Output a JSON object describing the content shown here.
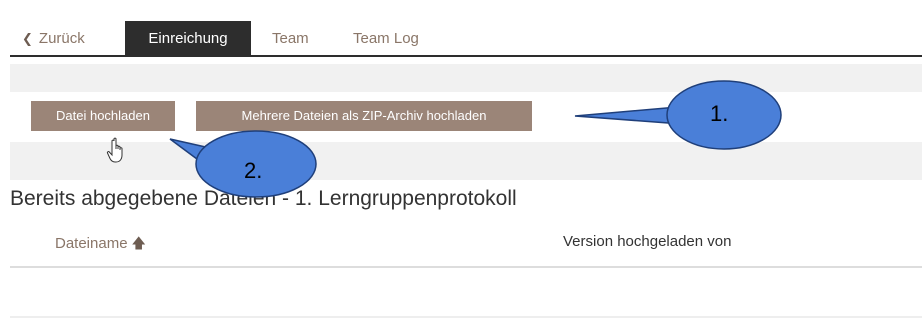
{
  "tabs": {
    "back_label": "Zurück",
    "active_label": "Einreichung",
    "team_label": "Team",
    "teamlog_label": "Team Log"
  },
  "buttons": {
    "upload_file": "Datei hochladen",
    "upload_zip": "Mehrere Dateien als ZIP-Archiv hochladen"
  },
  "section": {
    "title": "Bereits abgegebene Dateien - 1. Lerngruppenprotokoll"
  },
  "table": {
    "col_filename": "Dateiname",
    "col_version": "Version hochgeladen von"
  },
  "callouts": {
    "one": "1.",
    "two": "2."
  },
  "colors": {
    "button_bg": "#9b8578",
    "active_tab_bg": "#2d2d2d",
    "link_color": "#8a7668",
    "callout_fill": "#4a7fd8"
  },
  "icons": {
    "back": "chevron-left-icon",
    "sort": "arrow-up-icon",
    "cursor": "hand-pointer-icon"
  }
}
